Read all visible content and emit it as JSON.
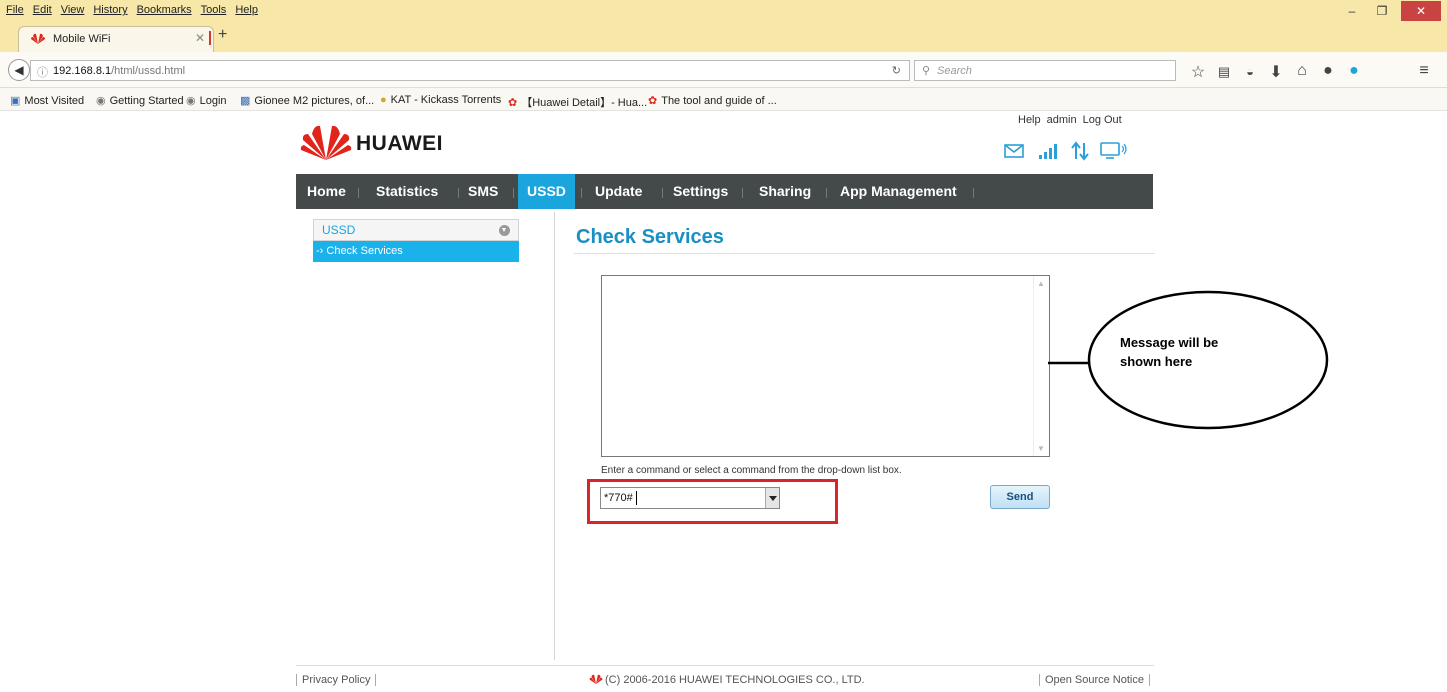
{
  "browser": {
    "menu": [
      "File",
      "Edit",
      "View",
      "History",
      "Bookmarks",
      "Tools",
      "Help"
    ],
    "tab_title": "Mobile WiFi",
    "url_host": "192.168.8.1",
    "url_path": "/html/ussd.html",
    "search_placeholder": "Search",
    "bookmarks": [
      "Most Visited",
      "Getting Started",
      "Login",
      "Gionee M2 pictures, of...",
      "KAT - Kickass Torrents",
      "【Huawei Detail】- Hua...",
      "The tool and guide of ..."
    ]
  },
  "header": {
    "brand": "HUAWEI",
    "links": [
      "Help",
      "admin",
      "Log Out"
    ]
  },
  "nav": {
    "items": [
      "Home",
      "Statistics",
      "SMS",
      "USSD",
      "Update",
      "Settings",
      "Sharing",
      "App Management"
    ],
    "active": "USSD"
  },
  "sidebar": {
    "section": "USSD",
    "item": "-› Check Services"
  },
  "main": {
    "title": "Check Services",
    "hint": "Enter a command or select a command from the drop-down list box.",
    "command_value": "*770#",
    "send_label": "Send"
  },
  "annotation": {
    "text": "Message will be shown here"
  },
  "footer": {
    "privacy": "Privacy Policy",
    "copyright": "(C) 2006-2016 HUAWEI TECHNOLOGIES CO., LTD.",
    "open_source": "Open Source Notice"
  },
  "colors": {
    "accent": "#1aa6dd",
    "nav_bg": "#444a4a",
    "highlight": "#d9242a",
    "brand_red": "#e1251b"
  }
}
